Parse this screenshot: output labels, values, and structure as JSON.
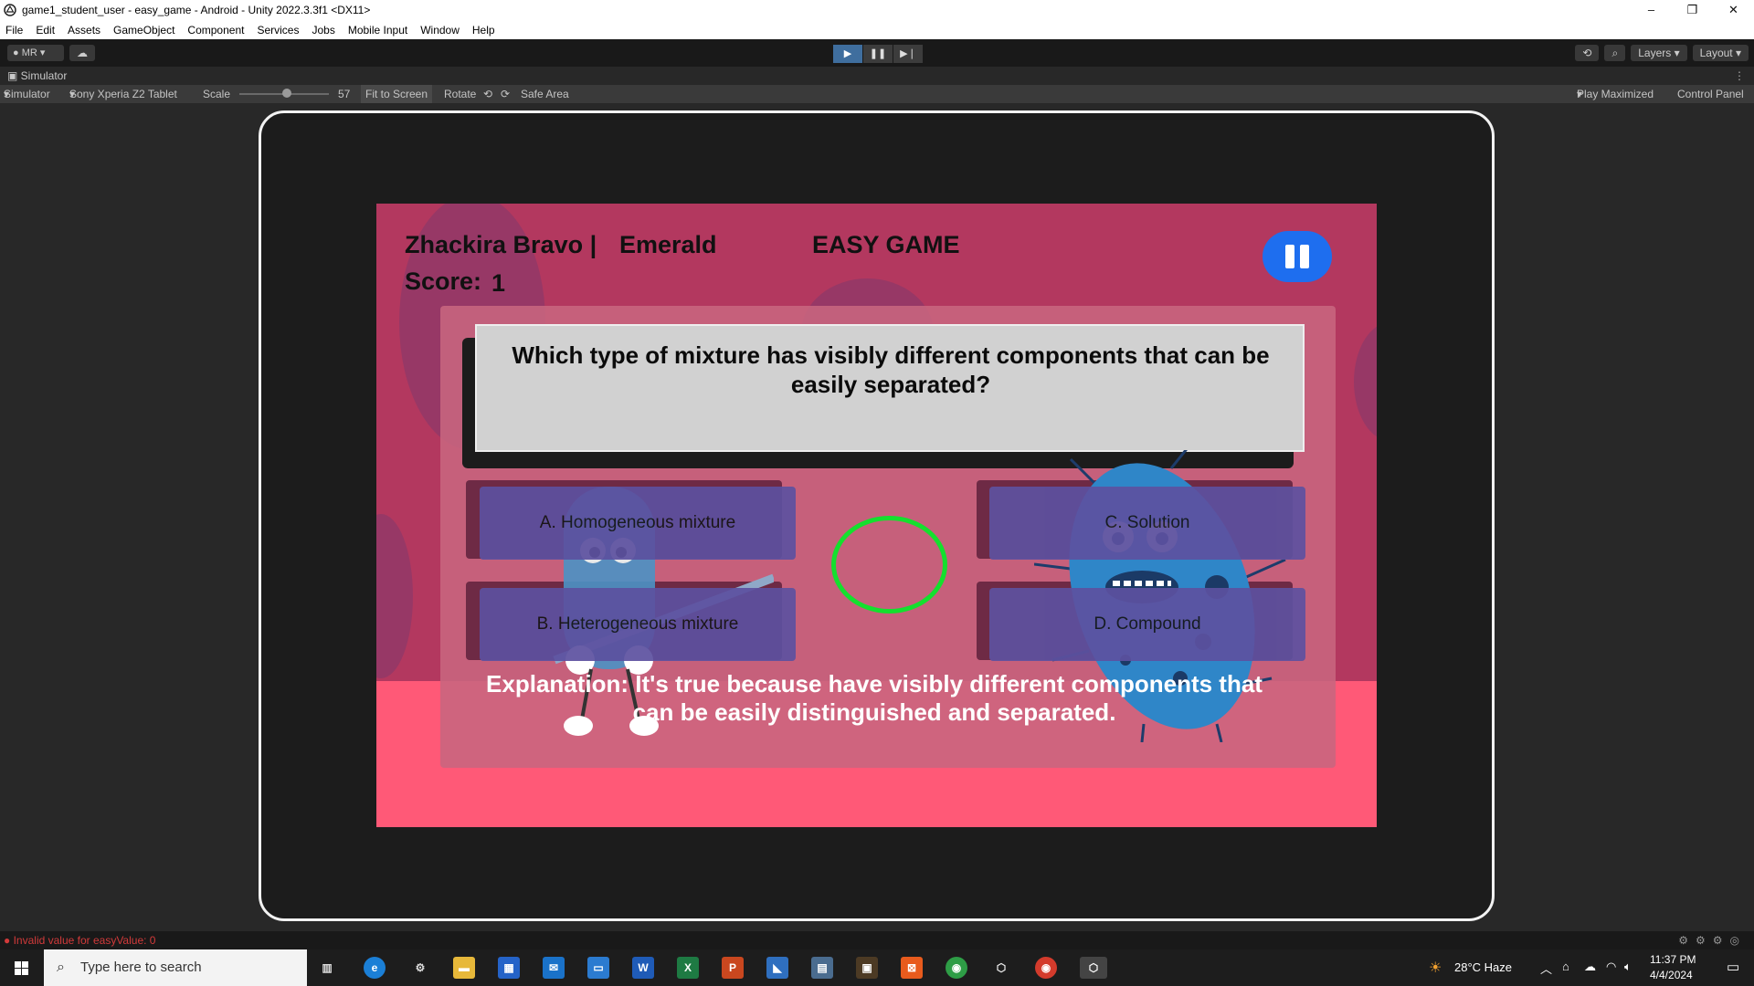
{
  "window": {
    "title": "game1_student_user - easy_game - Android - Unity 2022.3.3f1 <DX11>",
    "controls": [
      "–",
      "❐",
      "✕"
    ]
  },
  "menu": [
    "File",
    "Edit",
    "Assets",
    "GameObject",
    "Component",
    "Services",
    "Jobs",
    "Mobile Input",
    "Window",
    "Help"
  ],
  "toolbar": {
    "account": "MR",
    "layers": "Layers",
    "layout": "Layout"
  },
  "simulator_tab": {
    "label": "Simulator"
  },
  "simulator_bar": {
    "mode": "Simulator",
    "device": "Sony Xperia Z2 Tablet",
    "scale_label": "Scale",
    "scale_value": "57",
    "fit": "Fit to Screen",
    "rotate": "Rotate",
    "safe_area": "Safe Area",
    "play_mode": "Play Maximized",
    "control_panel": "Control Panel"
  },
  "game": {
    "player": "Zhackira Bravo |",
    "rank": "Emerald",
    "mode_title": "EASY GAME",
    "score_label": "Score:",
    "score_value": "1",
    "question": "Which type of mixture has visibly different components that can be easily separated?",
    "answers": [
      "A. Homogeneous mixture",
      "C. Solution",
      "B. Heterogeneous mixture",
      "D. Compound"
    ],
    "explanation": "Explanation: It's true because  have visibly different components that can be easily distinguished and separated."
  },
  "status": {
    "error": "Invalid value for easyValue: 0"
  },
  "taskbar": {
    "search_placeholder": "Type here to search",
    "weather": "28°C  Haze",
    "time": "11:37 PM",
    "date": "4/4/2024"
  },
  "colors": {
    "game_bg": "#b3385f",
    "game_bottom": "#ff5977",
    "ring": "#14e02e",
    "pause": "#1e6eef"
  }
}
